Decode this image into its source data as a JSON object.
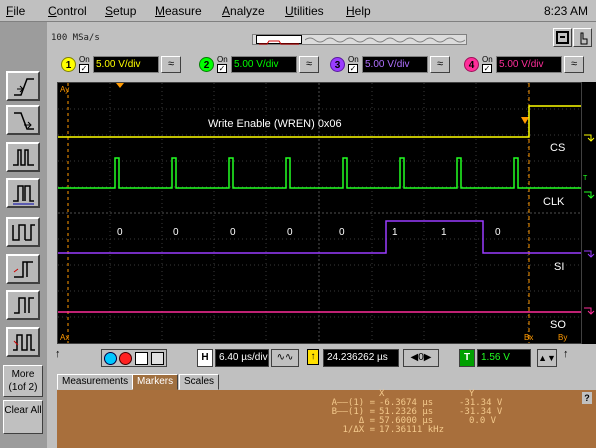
{
  "menu": {
    "items": [
      {
        "label": "File",
        "ul": "F",
        "rest": "ile"
      },
      {
        "label": "Control",
        "ul": "C",
        "rest": "ontrol"
      },
      {
        "label": "Setup",
        "ul": "S",
        "rest": "etup"
      },
      {
        "label": "Measure",
        "ul": "M",
        "rest": "easure"
      },
      {
        "label": "Analyze",
        "ul": "A",
        "rest": "nalyze"
      },
      {
        "label": "Utilities",
        "ul": "U",
        "rest": "tilities"
      },
      {
        "label": "Help",
        "ul": "H",
        "rest": "elp"
      }
    ],
    "clock": "8:23 AM"
  },
  "top": {
    "sample_rate": "100 MSa/s",
    "channels": [
      {
        "num": "1",
        "on": "On",
        "vdiv": "5.00 V/div",
        "color": "#ffff00"
      },
      {
        "num": "2",
        "on": "On",
        "vdiv": "5.00 V/div",
        "color": "#00ff00"
      },
      {
        "num": "3",
        "on": "On",
        "vdiv": "5.00 V/div",
        "color": "#9a3cff"
      },
      {
        "num": "4",
        "on": "On",
        "vdiv": "5.00 V/div",
        "color": "#ff2e9a"
      }
    ]
  },
  "scope": {
    "annotation": "Write Enable (WREN) 0x06",
    "bits": [
      "0",
      "0",
      "0",
      "0",
      "0",
      "1",
      "1",
      "0"
    ],
    "signal_labels": [
      "CS",
      "CLK",
      "SI",
      "SO"
    ],
    "marker_labels": {
      "ay": "Ay",
      "ax": "Ax",
      "bx": "Bx",
      "by": "By",
      "t": "T"
    },
    "colors": {
      "cs": "#ffff00",
      "clk": "#22ff22",
      "si": "#9a3cff",
      "so": "#ff2e9a",
      "marker": "#ff9900"
    }
  },
  "controls": {
    "hscale_label": "H",
    "hscale": "6.40 µs/div",
    "delay": "24.236262 µs",
    "trig_label": "T",
    "trig_level": "1.56 V"
  },
  "sidebar": {
    "more": "More (1of 2)",
    "clear": "Clear All"
  },
  "tabs": [
    "Measurements",
    "Markers",
    "Scales"
  ],
  "markers": {
    "header_x": "X",
    "header_y": "Y",
    "rows": [
      {
        "label": "A——(1) =",
        "x": "-6.3674 µs",
        "y": "-31.34 V"
      },
      {
        "label": "B——(1) =",
        "x": "51.2326 µs",
        "y": "-31.34 V"
      },
      {
        "label": "Δ =",
        "x": "57.6000 µs",
        "y": "0.0 V"
      },
      {
        "label": "1/ΔX =",
        "x": "17.36111 kHz",
        "y": ""
      }
    ]
  }
}
